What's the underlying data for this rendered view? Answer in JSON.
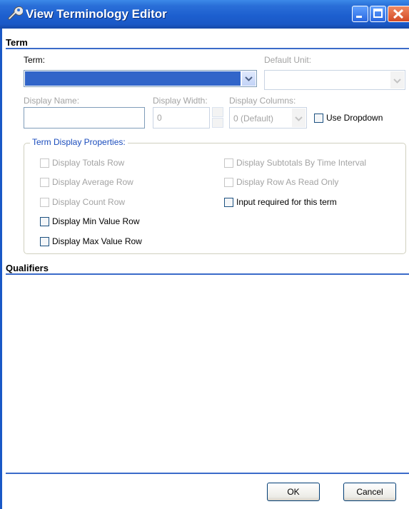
{
  "window": {
    "title": "View Terminology Editor"
  },
  "term_section": {
    "title": "Term",
    "term_label": "Term:",
    "default_unit_label": "Default Unit:",
    "display_name_label": "Display Name:",
    "display_name_value": "",
    "display_width_label": "Display Width:",
    "display_width_value": "0",
    "display_columns_label": "Display Columns:",
    "display_columns_value": "0 (Default)",
    "use_dropdown_label": "Use Dropdown"
  },
  "properties": {
    "legend": "Term Display Properties:",
    "left_options": [
      {
        "label": "Display Totals Row",
        "enabled": false,
        "checked": false
      },
      {
        "label": "Display Average Row",
        "enabled": false,
        "checked": false
      },
      {
        "label": "Display Count Row",
        "enabled": false,
        "checked": false
      },
      {
        "label": "Display Min Value Row",
        "enabled": true,
        "checked": false
      },
      {
        "label": "Display Max Value Row",
        "enabled": true,
        "checked": false
      }
    ],
    "right_options": [
      {
        "label": "Display Subtotals By Time Interval",
        "enabled": false,
        "checked": false
      },
      {
        "label": "Display Row As Read Only",
        "enabled": false,
        "checked": false
      },
      {
        "label": "Input required for this term",
        "enabled": true,
        "checked": false
      }
    ]
  },
  "qualifiers_section": {
    "title": "Qualifiers"
  },
  "buttons": {
    "ok": "OK",
    "cancel": "Cancel"
  },
  "colors": {
    "titlebar": "#1d5fcf",
    "selection": "#3165c9",
    "section_line": "#3b6bc9",
    "disabled_text": "#a3a3a3"
  }
}
